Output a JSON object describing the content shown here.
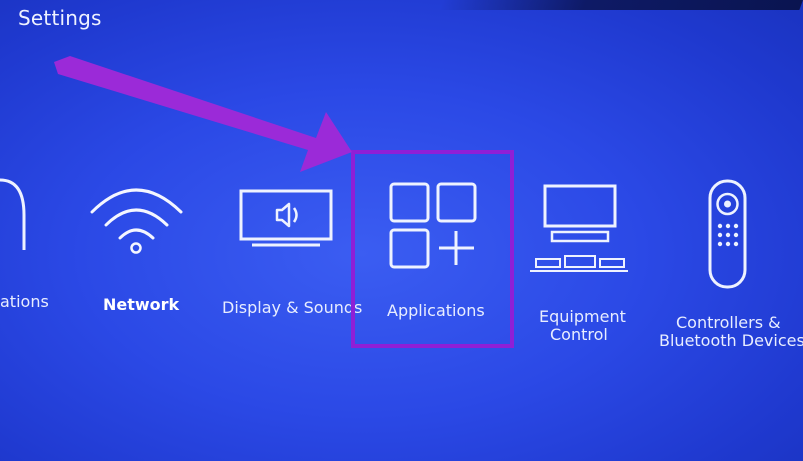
{
  "title": "Settings",
  "menu": {
    "items": [
      {
        "label": "ations",
        "icon": "notifications-icon"
      },
      {
        "label": "Network",
        "icon": "wifi-icon"
      },
      {
        "label": "Display & Sounds",
        "icon": "display-speaker-icon"
      },
      {
        "label": "Applications",
        "icon": "applications-grid-icon"
      },
      {
        "label_line1": "Equipment",
        "label_line2": "Control",
        "icon": "tv-equipment-icon"
      },
      {
        "label_line1": "Controllers &",
        "label_line2": "Bluetooth Devices",
        "icon": "remote-control-icon"
      }
    ],
    "selected_index": 3
  },
  "annotation": {
    "arrow_color": "#9b2ad8",
    "highlight_color": "#8f1fd6"
  }
}
